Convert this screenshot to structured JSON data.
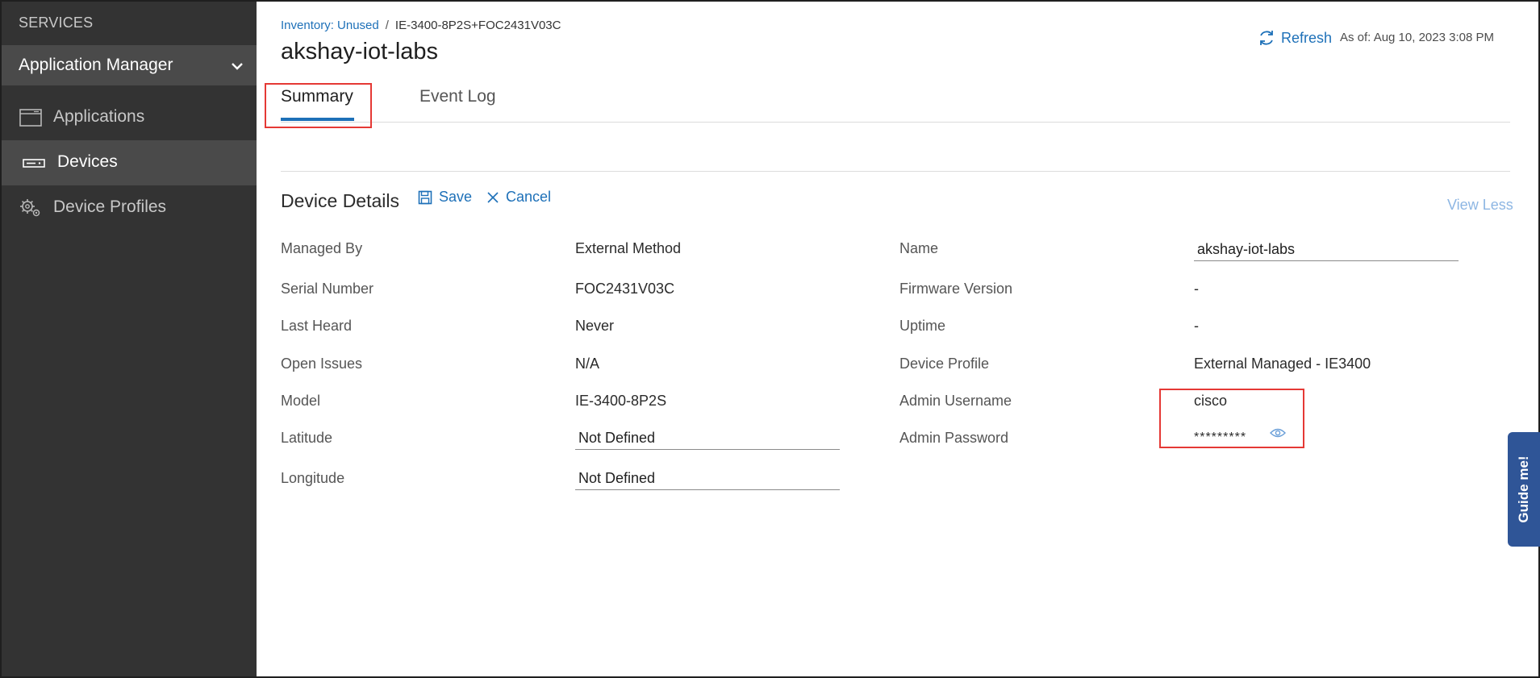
{
  "sidebar": {
    "services_label": "SERVICES",
    "app_manager_label": "Application Manager",
    "items": [
      {
        "label": "Applications",
        "icon": "window-icon"
      },
      {
        "label": "Devices",
        "icon": "device-icon"
      },
      {
        "label": "Device Profiles",
        "icon": "gears-icon"
      }
    ]
  },
  "header": {
    "breadcrumb_link": "Inventory: Unused",
    "breadcrumb_separator": "/",
    "breadcrumb_current": "IE-3400-8P2S+FOC2431V03C",
    "title": "akshay-iot-labs",
    "refresh_label": "Refresh",
    "as_of": "As of: Aug 10, 2023 3:08 PM"
  },
  "tabs": [
    {
      "label": "Summary",
      "active": true
    },
    {
      "label": "Event Log",
      "active": false
    }
  ],
  "device_details": {
    "title": "Device Details",
    "save_label": "Save",
    "cancel_label": "Cancel",
    "view_less_label": "View Less",
    "left_fields": {
      "managed_by": {
        "label": "Managed By",
        "value": "External Method"
      },
      "serial_number": {
        "label": "Serial Number",
        "value": "FOC2431V03C"
      },
      "last_heard": {
        "label": "Last Heard",
        "value": "Never"
      },
      "open_issues": {
        "label": "Open Issues",
        "value": "N/A"
      },
      "model": {
        "label": "Model",
        "value": "IE-3400-8P2S"
      },
      "latitude": {
        "label": "Latitude",
        "value": "Not Defined"
      },
      "longitude": {
        "label": "Longitude",
        "value": "Not Defined"
      }
    },
    "right_fields": {
      "name": {
        "label": "Name",
        "value": "akshay-iot-labs"
      },
      "firmware_version": {
        "label": "Firmware Version",
        "value": "-"
      },
      "uptime": {
        "label": "Uptime",
        "value": "-"
      },
      "device_profile": {
        "label": "Device Profile",
        "value": "External Managed - IE3400"
      },
      "admin_username": {
        "label": "Admin Username",
        "value": "cisco"
      },
      "admin_password": {
        "label": "Admin Password",
        "value": "*********"
      }
    }
  },
  "guide_me_label": "Guide me!",
  "colors": {
    "accent": "#1d70b8",
    "sidebar_bg": "#333333",
    "highlight": "#e53935",
    "guide_me_bg": "#2f5597"
  }
}
